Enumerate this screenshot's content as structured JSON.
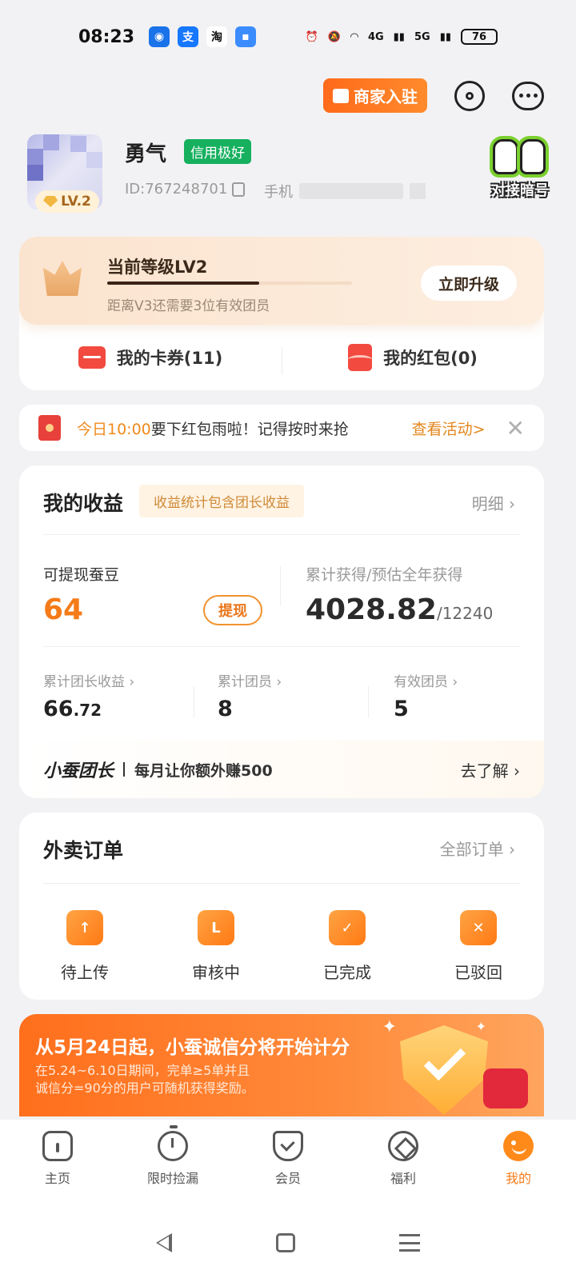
{
  "status": {
    "time": "08:23",
    "battery": "76",
    "net1": "4G",
    "net2": "5G",
    "app_alipay": "支",
    "app_taobao": "淘"
  },
  "header": {
    "merchant_label": "商家入驻"
  },
  "profile": {
    "name": "勇气",
    "credit_badge": "信用极好",
    "id_text": "ID:767248701",
    "phone_label": "手机",
    "level_badge": "LV.2",
    "secret_label": "对接暗号"
  },
  "level_card": {
    "title": "当前等级LV2",
    "progress": 0.62,
    "subtitle": "距离V3还需要3位有效团员",
    "upgrade_label": "立即升级",
    "coupons_label": "我的卡券(11)",
    "redpacks_label": "我的红包(0)"
  },
  "notice": {
    "time": "今日10:00",
    "text": "要下红包雨啦！记得按时来抢",
    "link": "查看活动>",
    "close": "✕"
  },
  "income": {
    "title": "我的收益",
    "tag": "收益统计包含团长收益",
    "detail": "明细 ›",
    "cash_label": "可提现蚕豆",
    "cash_value": "64",
    "withdraw": "提现",
    "total_label": "累计获得/预估全年获得",
    "total_value": "4028.82",
    "total_estimate": "/12240",
    "stats": [
      {
        "label": "累计团长收益 ›",
        "value": "66",
        "decimal": ".72"
      },
      {
        "label": "累计团员 ›",
        "value": "8",
        "decimal": ""
      },
      {
        "label": "有效团员 ›",
        "value": "5",
        "decimal": ""
      }
    ],
    "leader_title": "小蚕团长",
    "leader_desc": "每月让你额外赚500",
    "leader_more": "去了解 ›"
  },
  "orders": {
    "title": "外卖订单",
    "all": "全部订单 ›",
    "items": [
      {
        "label": "待上传",
        "glyph": "↑"
      },
      {
        "label": "审核中",
        "glyph": "L"
      },
      {
        "label": "已完成",
        "glyph": "✓"
      },
      {
        "label": "已驳回",
        "glyph": "✕"
      }
    ]
  },
  "banner": {
    "title": "从5月24日起，小蚕诚信分将开始计分",
    "line1": "在5.24~6.10日期间，完单≥5单并且",
    "line2": "诚信分=90分的用户可随机获得奖励。",
    "spark": "✦"
  },
  "tabs": [
    {
      "label": "主页"
    },
    {
      "label": "限时捡漏"
    },
    {
      "label": "会员"
    },
    {
      "label": "福利"
    },
    {
      "label": "我的"
    }
  ],
  "colors": {
    "accent": "#f57b19",
    "credit": "#16b05f",
    "red": "#f24a3f"
  }
}
